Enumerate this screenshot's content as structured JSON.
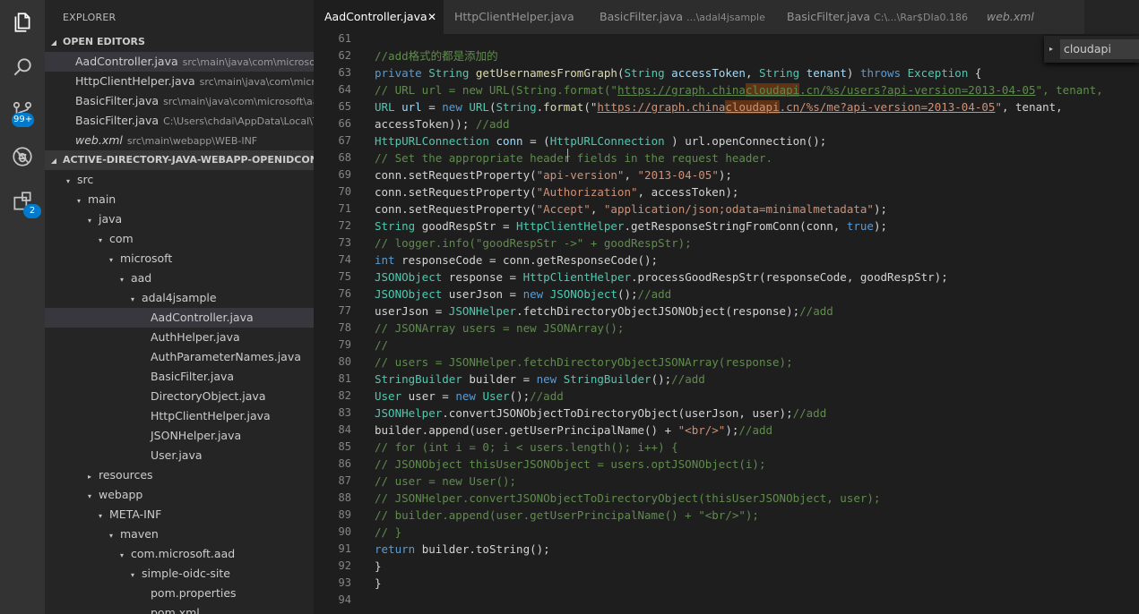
{
  "activity_bar": {
    "scm_badge": "99+",
    "extensions_badge": "2",
    "icons": [
      "files-icon",
      "search-icon",
      "source-control-icon",
      "debug-icon",
      "extensions-icon"
    ]
  },
  "explorer": {
    "title": "EXPLORER",
    "open_editors": {
      "title": "OPEN EDITORS",
      "items": [
        {
          "name": "AadController.java",
          "path": "src\\main\\java\\com\\microsof..."
        },
        {
          "name": "HttpClientHelper.java",
          "path": "src\\main\\java\\com\\micro..."
        },
        {
          "name": "BasicFilter.java",
          "path": "src\\main\\java\\com\\microsoft\\aa..."
        },
        {
          "name": "BasicFilter.java",
          "path": "C:\\Users\\chdai\\AppData\\Local\\Te..."
        },
        {
          "name": "web.xml",
          "path": "src\\main\\webapp\\WEB-INF"
        }
      ]
    },
    "project": {
      "title": "ACTIVE-DIRECTORY-JAVA-WEBAPP-OPENIDCONNEC...",
      "tree": [
        {
          "label": "src",
          "twisty": "▾"
        },
        {
          "label": "main",
          "twisty": "▾"
        },
        {
          "label": "java",
          "twisty": "▾"
        },
        {
          "label": "com",
          "twisty": "▾"
        },
        {
          "label": "microsoft",
          "twisty": "▾"
        },
        {
          "label": "aad",
          "twisty": "▾"
        },
        {
          "label": "adal4jsample",
          "twisty": "▾"
        },
        {
          "label": "AadController.java",
          "twisty": ""
        },
        {
          "label": "AuthHelper.java",
          "twisty": ""
        },
        {
          "label": "AuthParameterNames.java",
          "twisty": ""
        },
        {
          "label": "BasicFilter.java",
          "twisty": ""
        },
        {
          "label": "DirectoryObject.java",
          "twisty": ""
        },
        {
          "label": "HttpClientHelper.java",
          "twisty": ""
        },
        {
          "label": "JSONHelper.java",
          "twisty": ""
        },
        {
          "label": "User.java",
          "twisty": ""
        },
        {
          "label": "resources",
          "twisty": "▸"
        },
        {
          "label": "webapp",
          "twisty": "▾"
        },
        {
          "label": "META-INF",
          "twisty": "▾"
        },
        {
          "label": "maven",
          "twisty": "▾"
        },
        {
          "label": "com.microsoft.aad",
          "twisty": "▾"
        },
        {
          "label": "simple-oidc-site",
          "twisty": "▾"
        },
        {
          "label": "pom.properties",
          "twisty": ""
        },
        {
          "label": "pom.xml",
          "twisty": ""
        }
      ]
    }
  },
  "tabs": [
    {
      "name": "AadController.java",
      "sub": "",
      "close": "✕"
    },
    {
      "name": "HttpClientHelper.java",
      "sub": ""
    },
    {
      "name": "BasicFilter.java",
      "sub": "...\\adal4jsample"
    },
    {
      "name": "BasicFilter.java",
      "sub": "C:\\...\\Rar$DIa0.186"
    },
    {
      "name": "web.xml",
      "sub": ""
    }
  ],
  "find_widget": {
    "value": "cloudapi",
    "toggle": "▸"
  },
  "editor": {
    "lines": [
      {
        "n": "61",
        "t": []
      },
      {
        "n": "62",
        "t": [
          [
            "cm",
            "//add格式的都是添加的"
          ]
        ]
      },
      {
        "n": "63",
        "t": [
          [
            "kw",
            "private "
          ],
          [
            "ty",
            "String "
          ],
          [
            "fn",
            "getUsernamesFromGraph"
          ],
          [
            "",
            "("
          ],
          [
            "ty",
            "String "
          ],
          [
            "pa",
            "accessToken"
          ],
          [
            "",
            ", "
          ],
          [
            "ty",
            "String "
          ],
          [
            "pa",
            "tenant"
          ],
          [
            "",
            ") "
          ],
          [
            "kw",
            "throws "
          ],
          [
            "ty",
            "Exception"
          ],
          [
            "",
            " {"
          ]
        ]
      },
      {
        "n": "64",
        "t": [
          [
            "cm",
            "// URL url = new URL(String.format(\""
          ],
          [
            "cm ul",
            "https://graph.china"
          ],
          [
            "cm ul hl",
            "cloudapi"
          ],
          [
            "cm ul",
            ".cn/%s/users?api-version=2013-04-05"
          ],
          [
            "cm",
            "\", tenant,"
          ]
        ]
      },
      {
        "n": "65",
        "t": [
          [
            "ty",
            "URL "
          ],
          [
            "pa",
            "url"
          ],
          [
            "",
            " = "
          ],
          [
            "kw",
            "new "
          ],
          [
            "ty",
            "URL"
          ],
          [
            "",
            "("
          ],
          [
            "ty",
            "String"
          ],
          [
            "",
            "."
          ],
          [
            "fn",
            "format"
          ],
          [
            "",
            "(\""
          ],
          [
            "st ul",
            "https://graph.china"
          ],
          [
            "st ul hl",
            "cloudapi"
          ],
          [
            "st ul",
            ".cn/%s/me?api-version=2013-04-05"
          ],
          [
            "st",
            "\""
          ],
          [
            "",
            ", tenant,"
          ]
        ]
      },
      {
        "n": "66",
        "t": [
          [
            "",
            "accessToken)); "
          ],
          [
            "cm",
            "//add"
          ]
        ]
      },
      {
        "n": "67",
        "t": [
          [
            "ty",
            "HttpURLConnection "
          ],
          [
            "pa",
            "conn"
          ],
          [
            "",
            " = ("
          ],
          [
            "ty",
            "HttpURLConnection"
          ],
          [
            "",
            " ) url.openConnection();"
          ]
        ]
      },
      {
        "n": "68",
        "t": [
          [
            "cm",
            "// Set the appropriate header fields in the request header."
          ]
        ]
      },
      {
        "n": "69",
        "t": [
          [
            "",
            "conn.setRequestProperty("
          ],
          [
            "st",
            "\"api-version\""
          ],
          [
            "",
            ", "
          ],
          [
            "st",
            "\"2013-04-05\""
          ],
          [
            "",
            ");"
          ]
        ]
      },
      {
        "n": "70",
        "t": [
          [
            "",
            "conn.setRequestProperty("
          ],
          [
            "st",
            "\"Authorization\""
          ],
          [
            "",
            ", accessToken);"
          ]
        ]
      },
      {
        "n": "71",
        "t": [
          [
            "",
            "conn.setRequestProperty("
          ],
          [
            "st",
            "\"Accept\""
          ],
          [
            "",
            ", "
          ],
          [
            "st",
            "\"application/json;odata=minimalmetadata\""
          ],
          [
            "",
            ");"
          ]
        ]
      },
      {
        "n": "72",
        "t": [
          [
            "ty",
            "String "
          ],
          [
            "",
            "goodRespStr = "
          ],
          [
            "ty",
            "HttpClientHelper"
          ],
          [
            "",
            ".getResponseStringFromConn(conn, "
          ],
          [
            "kw",
            "true"
          ],
          [
            "",
            ");"
          ]
        ]
      },
      {
        "n": "73",
        "t": [
          [
            "cm",
            "// logger.info(\"goodRespStr ->\" + goodRespStr);"
          ]
        ]
      },
      {
        "n": "74",
        "t": [
          [
            "kw",
            "int "
          ],
          [
            "",
            "responseCode = conn.getResponseCode();"
          ]
        ]
      },
      {
        "n": "75",
        "t": [
          [
            "ty",
            "JSONObject "
          ],
          [
            "",
            "response = "
          ],
          [
            "ty",
            "HttpClientHelper"
          ],
          [
            "",
            ".processGoodRespStr(responseCode, goodRespStr);"
          ]
        ]
      },
      {
        "n": "76",
        "t": [
          [
            "ty",
            "JSONObject "
          ],
          [
            "",
            "userJson = "
          ],
          [
            "kw",
            "new "
          ],
          [
            "ty",
            "JSONObject"
          ],
          [
            "",
            "();"
          ],
          [
            "cm",
            "//add"
          ]
        ]
      },
      {
        "n": "77",
        "t": [
          [
            "",
            "userJson = "
          ],
          [
            "ty",
            "JSONHelper"
          ],
          [
            "",
            ".fetchDirectoryObjectJSONObject(response);"
          ],
          [
            "cm",
            "//add"
          ]
        ]
      },
      {
        "n": "78",
        "t": [
          [
            "cm",
            "// JSONArray users = new JSONArray();"
          ]
        ]
      },
      {
        "n": "79",
        "t": [
          [
            "cm",
            "//"
          ]
        ]
      },
      {
        "n": "80",
        "t": [
          [
            "cm",
            "// users = JSONHelper.fetchDirectoryObjectJSONArray(response);"
          ]
        ]
      },
      {
        "n": "81",
        "t": [
          [
            "ty",
            "StringBuilder "
          ],
          [
            "",
            "builder = "
          ],
          [
            "kw",
            "new "
          ],
          [
            "ty",
            "StringBuilder"
          ],
          [
            "",
            "();"
          ],
          [
            "cm",
            "//add"
          ]
        ]
      },
      {
        "n": "82",
        "t": [
          [
            "ty",
            "User "
          ],
          [
            "",
            "user = "
          ],
          [
            "kw",
            "new "
          ],
          [
            "ty",
            "User"
          ],
          [
            "",
            "();"
          ],
          [
            "cm",
            "//add"
          ]
        ]
      },
      {
        "n": "83",
        "t": [
          [
            "ty",
            "JSONHelper"
          ],
          [
            "",
            ".convertJSONObjectToDirectoryObject(userJson, user);"
          ],
          [
            "cm",
            "//add"
          ]
        ]
      },
      {
        "n": "84",
        "t": [
          [
            "",
            "builder.append(user.getUserPrincipalName() + "
          ],
          [
            "st",
            "\"<br/>\""
          ],
          [
            "",
            ");"
          ],
          [
            "cm",
            "//add"
          ]
        ]
      },
      {
        "n": "85",
        "t": [
          [
            "cm",
            "// for (int i = 0; i < users.length(); i++) {"
          ]
        ]
      },
      {
        "n": "86",
        "t": [
          [
            "cm",
            "// JSONObject thisUserJSONObject = users.optJSONObject(i);"
          ]
        ]
      },
      {
        "n": "87",
        "t": [
          [
            "cm",
            "// user = new User();"
          ]
        ]
      },
      {
        "n": "88",
        "t": [
          [
            "cm",
            "// JSONHelper.convertJSONObjectToDirectoryObject(thisUserJSONObject, user);"
          ]
        ]
      },
      {
        "n": "89",
        "t": [
          [
            "cm",
            "// builder.append(user.getUserPrincipalName() + \"<br/>\");"
          ]
        ]
      },
      {
        "n": "90",
        "t": [
          [
            "cm",
            "// }"
          ]
        ]
      },
      {
        "n": "91",
        "t": [
          [
            "kw",
            "return "
          ],
          [
            "",
            "builder.toString();"
          ]
        ]
      },
      {
        "n": "92",
        "t": [
          [
            "",
            "}"
          ]
        ]
      },
      {
        "n": "93",
        "t": [
          [
            "",
            "}"
          ]
        ]
      },
      {
        "n": "94",
        "t": []
      }
    ]
  }
}
